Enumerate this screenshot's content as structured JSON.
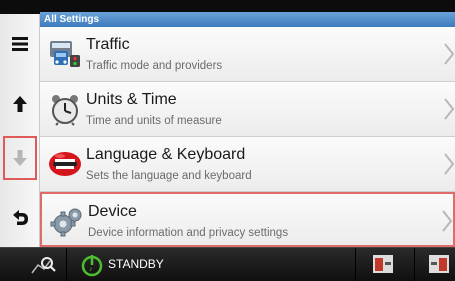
{
  "header": {
    "title": "All Settings"
  },
  "nav": {
    "icons": [
      "menu-icon",
      "arrow-up-icon",
      "arrow-down-icon",
      "back-icon"
    ],
    "selected_color": "#e05a5a"
  },
  "rows": [
    {
      "title": "Traffic",
      "subtitle": "Traffic mode and providers",
      "icon": "traffic-icon"
    },
    {
      "title": "Units & Time",
      "subtitle": "Time and units of measure",
      "icon": "clock-icon"
    },
    {
      "title": "Language & Keyboard",
      "subtitle": "Sets the language and keyboard",
      "icon": "mouth-icon"
    },
    {
      "title": "Device",
      "subtitle": "Device information and privacy settings",
      "icon": "gears-icon"
    }
  ],
  "bottom": {
    "standby_label": "STANDBY"
  },
  "colors": {
    "header": "#4a89c9",
    "highlight": "#e06b6b",
    "bottom_bg": "#151515"
  }
}
